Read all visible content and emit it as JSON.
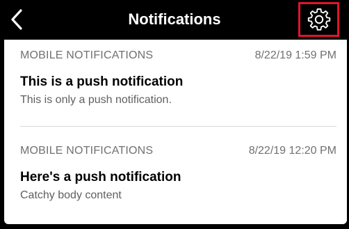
{
  "header": {
    "title": "Notifications",
    "back_icon": "chevron-left-icon",
    "settings_icon": "gear-icon",
    "highlight_color": "#e0142d"
  },
  "notifications": [
    {
      "source": "MOBILE NOTIFICATIONS",
      "timestamp": "8/22/19 1:59 PM",
      "title": "This is a push notification",
      "body": "This is only a push notification."
    },
    {
      "source": "MOBILE NOTIFICATIONS",
      "timestamp": "8/22/19 12:20 PM",
      "title": "Here's a push notification",
      "body": "Catchy body content"
    }
  ]
}
